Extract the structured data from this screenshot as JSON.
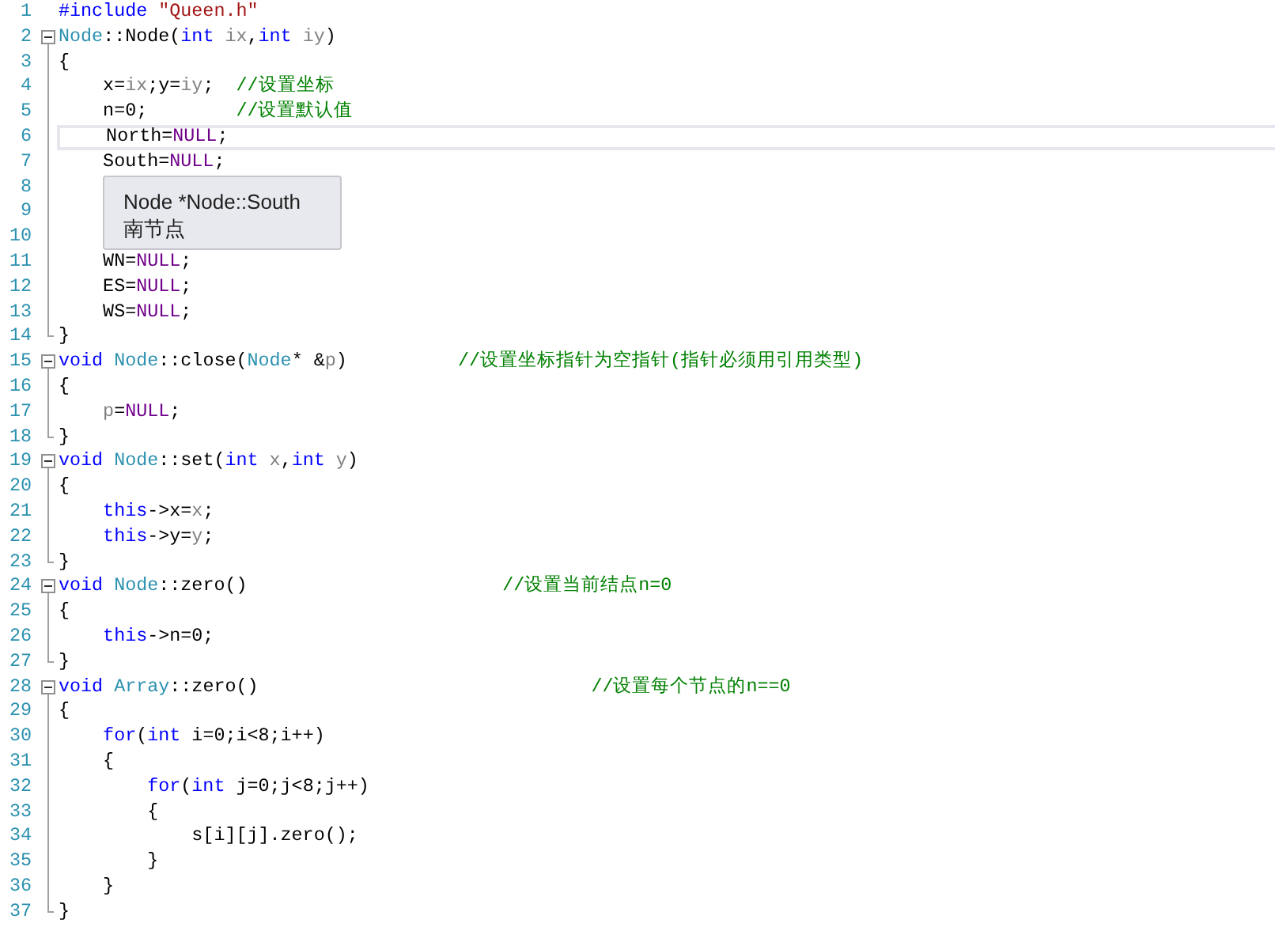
{
  "lines": [
    {
      "number": "1",
      "kind": "plain",
      "current": false,
      "tokens": [
        {
          "kind": "keyword",
          "text": "#include "
        },
        {
          "kind": "string",
          "text": "\"Queen.h\""
        }
      ]
    },
    {
      "number": "2",
      "kind": "fold-start",
      "current": false,
      "tokens": [
        {
          "kind": "type",
          "text": "Node"
        },
        {
          "kind": "plain",
          "text": "::Node("
        },
        {
          "kind": "keyword",
          "text": "int"
        },
        {
          "kind": "param",
          "text": " ix"
        },
        {
          "kind": "plain",
          "text": ","
        },
        {
          "kind": "keyword",
          "text": "int"
        },
        {
          "kind": "param",
          "text": " iy"
        },
        {
          "kind": "plain",
          "text": ")"
        }
      ]
    },
    {
      "number": "3",
      "kind": "block",
      "current": false,
      "tokens": [
        {
          "kind": "plain",
          "text": "{"
        }
      ]
    },
    {
      "number": "4",
      "kind": "block",
      "current": false,
      "tokens": [
        {
          "kind": "plain",
          "text": "    x="
        },
        {
          "kind": "param",
          "text": "ix"
        },
        {
          "kind": "plain",
          "text": ";y="
        },
        {
          "kind": "param",
          "text": "iy"
        },
        {
          "kind": "plain",
          "text": ";  "
        },
        {
          "kind": "comment",
          "text": "//设置坐标"
        }
      ]
    },
    {
      "number": "5",
      "kind": "block",
      "current": false,
      "tokens": [
        {
          "kind": "plain",
          "text": "    n=0;        "
        },
        {
          "kind": "comment",
          "text": "//设置默认值"
        }
      ]
    },
    {
      "number": "6",
      "kind": "block",
      "current": true,
      "tokens": [
        {
          "kind": "plain",
          "text": "    North="
        },
        {
          "kind": "macro",
          "text": "NULL"
        },
        {
          "kind": "plain",
          "text": ";"
        }
      ]
    },
    {
      "number": "7",
      "kind": "block",
      "current": false,
      "tokens": [
        {
          "kind": "plain",
          "text": "    South="
        },
        {
          "kind": "macro",
          "text": "NULL"
        },
        {
          "kind": "plain",
          "text": ";"
        }
      ]
    },
    {
      "number": "8",
      "kind": "block",
      "current": false
    },
    {
      "number": "9",
      "kind": "block",
      "current": false
    },
    {
      "number": "10",
      "kind": "block",
      "current": false
    },
    {
      "number": "11",
      "kind": "block",
      "current": false,
      "tokens": [
        {
          "kind": "plain",
          "text": "    WN="
        },
        {
          "kind": "macro",
          "text": "NULL"
        },
        {
          "kind": "plain",
          "text": ";"
        }
      ]
    },
    {
      "number": "12",
      "kind": "block",
      "current": false,
      "tokens": [
        {
          "kind": "plain",
          "text": "    ES="
        },
        {
          "kind": "macro",
          "text": "NULL"
        },
        {
          "kind": "plain",
          "text": ";"
        }
      ]
    },
    {
      "number": "13",
      "kind": "block",
      "current": false,
      "tokens": [
        {
          "kind": "plain",
          "text": "    WS="
        },
        {
          "kind": "macro",
          "text": "NULL"
        },
        {
          "kind": "plain",
          "text": ";"
        }
      ]
    },
    {
      "number": "14",
      "kind": "block-end",
      "current": false,
      "tokens": [
        {
          "kind": "plain",
          "text": "}"
        }
      ]
    },
    {
      "number": "15",
      "kind": "fold-start",
      "current": false,
      "tokens": [
        {
          "kind": "keyword",
          "text": "void "
        },
        {
          "kind": "type",
          "text": "Node"
        },
        {
          "kind": "plain",
          "text": "::close("
        },
        {
          "kind": "type",
          "text": "Node"
        },
        {
          "kind": "plain",
          "text": "* &"
        },
        {
          "kind": "param",
          "text": "p"
        },
        {
          "kind": "plain",
          "text": ")          "
        },
        {
          "kind": "comment",
          "text": "//设置坐标指针为空指针(指针必须用引用类型)"
        }
      ]
    },
    {
      "number": "16",
      "kind": "block",
      "current": false,
      "tokens": [
        {
          "kind": "plain",
          "text": "{"
        }
      ]
    },
    {
      "number": "17",
      "kind": "block",
      "current": false,
      "tokens": [
        {
          "kind": "param",
          "text": "    p"
        },
        {
          "kind": "plain",
          "text": "="
        },
        {
          "kind": "macro",
          "text": "NULL"
        },
        {
          "kind": "plain",
          "text": ";"
        }
      ]
    },
    {
      "number": "18",
      "kind": "block-end",
      "current": false,
      "tokens": [
        {
          "kind": "plain",
          "text": "}"
        }
      ]
    },
    {
      "number": "19",
      "kind": "fold-start",
      "current": false,
      "tokens": [
        {
          "kind": "keyword",
          "text": "void "
        },
        {
          "kind": "type",
          "text": "Node"
        },
        {
          "kind": "plain",
          "text": "::set("
        },
        {
          "kind": "keyword",
          "text": "int"
        },
        {
          "kind": "param",
          "text": " x"
        },
        {
          "kind": "plain",
          "text": ","
        },
        {
          "kind": "keyword",
          "text": "int"
        },
        {
          "kind": "param",
          "text": " y"
        },
        {
          "kind": "plain",
          "text": ")"
        }
      ]
    },
    {
      "number": "20",
      "kind": "block",
      "current": false,
      "tokens": [
        {
          "kind": "plain",
          "text": "{"
        }
      ]
    },
    {
      "number": "21",
      "kind": "block",
      "current": false,
      "tokens": [
        {
          "kind": "keyword",
          "text": "    this"
        },
        {
          "kind": "plain",
          "text": "->x="
        },
        {
          "kind": "param",
          "text": "x"
        },
        {
          "kind": "plain",
          "text": ";"
        }
      ]
    },
    {
      "number": "22",
      "kind": "block",
      "current": false,
      "tokens": [
        {
          "kind": "keyword",
          "text": "    this"
        },
        {
          "kind": "plain",
          "text": "->y="
        },
        {
          "kind": "param",
          "text": "y"
        },
        {
          "kind": "plain",
          "text": ";"
        }
      ]
    },
    {
      "number": "23",
      "kind": "block-end",
      "current": false,
      "tokens": [
        {
          "kind": "plain",
          "text": "}"
        }
      ]
    },
    {
      "number": "24",
      "kind": "fold-start",
      "current": false,
      "tokens": [
        {
          "kind": "keyword",
          "text": "void "
        },
        {
          "kind": "type",
          "text": "Node"
        },
        {
          "kind": "plain",
          "text": "::zero()                       "
        },
        {
          "kind": "comment",
          "text": "//设置当前结点n=0"
        }
      ]
    },
    {
      "number": "25",
      "kind": "block",
      "current": false,
      "tokens": [
        {
          "kind": "plain",
          "text": "{"
        }
      ]
    },
    {
      "number": "26",
      "kind": "block",
      "current": false,
      "tokens": [
        {
          "kind": "keyword",
          "text": "    this"
        },
        {
          "kind": "plain",
          "text": "->n=0;"
        }
      ]
    },
    {
      "number": "27",
      "kind": "block-end",
      "current": false,
      "tokens": [
        {
          "kind": "plain",
          "text": "}"
        }
      ]
    },
    {
      "number": "28",
      "kind": "fold-start",
      "current": false,
      "tokens": [
        {
          "kind": "keyword",
          "text": "void "
        },
        {
          "kind": "type",
          "text": "Array"
        },
        {
          "kind": "plain",
          "text": "::zero()                              "
        },
        {
          "kind": "comment",
          "text": "//设置每个节点的n==0"
        }
      ]
    },
    {
      "number": "29",
      "kind": "block",
      "current": false,
      "tokens": [
        {
          "kind": "plain",
          "text": "{"
        }
      ]
    },
    {
      "number": "30",
      "kind": "block",
      "current": false,
      "tokens": [
        {
          "kind": "keyword",
          "text": "    for"
        },
        {
          "kind": "plain",
          "text": "("
        },
        {
          "kind": "keyword",
          "text": "int"
        },
        {
          "kind": "plain",
          "text": " i=0;i<8;i++)"
        }
      ]
    },
    {
      "number": "31",
      "kind": "block",
      "current": false,
      "tokens": [
        {
          "kind": "plain",
          "text": "    {"
        }
      ]
    },
    {
      "number": "32",
      "kind": "block",
      "current": false,
      "tokens": [
        {
          "kind": "keyword",
          "text": "        for"
        },
        {
          "kind": "plain",
          "text": "("
        },
        {
          "kind": "keyword",
          "text": "int"
        },
        {
          "kind": "plain",
          "text": " j=0;j<8;j++)"
        }
      ]
    },
    {
      "number": "33",
      "kind": "block",
      "current": false,
      "tokens": [
        {
          "kind": "plain",
          "text": "        {"
        }
      ]
    },
    {
      "number": "34",
      "kind": "block",
      "current": false,
      "tokens": [
        {
          "kind": "plain",
          "text": "            s[i][j].zero();"
        }
      ]
    },
    {
      "number": "35",
      "kind": "block",
      "current": false,
      "tokens": [
        {
          "kind": "plain",
          "text": "        }"
        }
      ]
    },
    {
      "number": "36",
      "kind": "block",
      "current": false,
      "tokens": [
        {
          "kind": "plain",
          "text": "    }"
        }
      ]
    },
    {
      "number": "37",
      "kind": "block-end",
      "current": false,
      "tokens": [
        {
          "kind": "plain",
          "text": "}"
        }
      ]
    }
  ],
  "tooltip": {
    "signature": "Node *Node::South",
    "description": "南节点"
  }
}
